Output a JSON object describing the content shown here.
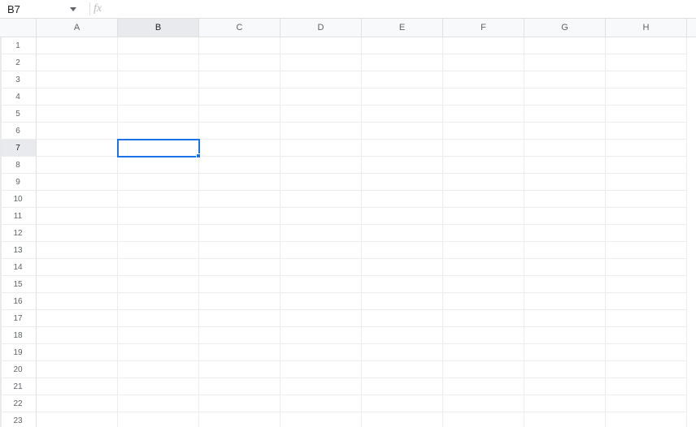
{
  "formula_bar": {
    "cell_reference": "B7",
    "formula_value": ""
  },
  "columns": [
    "A",
    "B",
    "C",
    "D",
    "E",
    "F",
    "G",
    "H"
  ],
  "rows": [
    "1",
    "2",
    "3",
    "4",
    "5",
    "6",
    "7",
    "8",
    "9",
    "10",
    "11",
    "12",
    "13",
    "14",
    "15",
    "16",
    "17",
    "18",
    "19",
    "20",
    "21",
    "22",
    "23"
  ],
  "selected": {
    "col": "B",
    "row": "7"
  }
}
